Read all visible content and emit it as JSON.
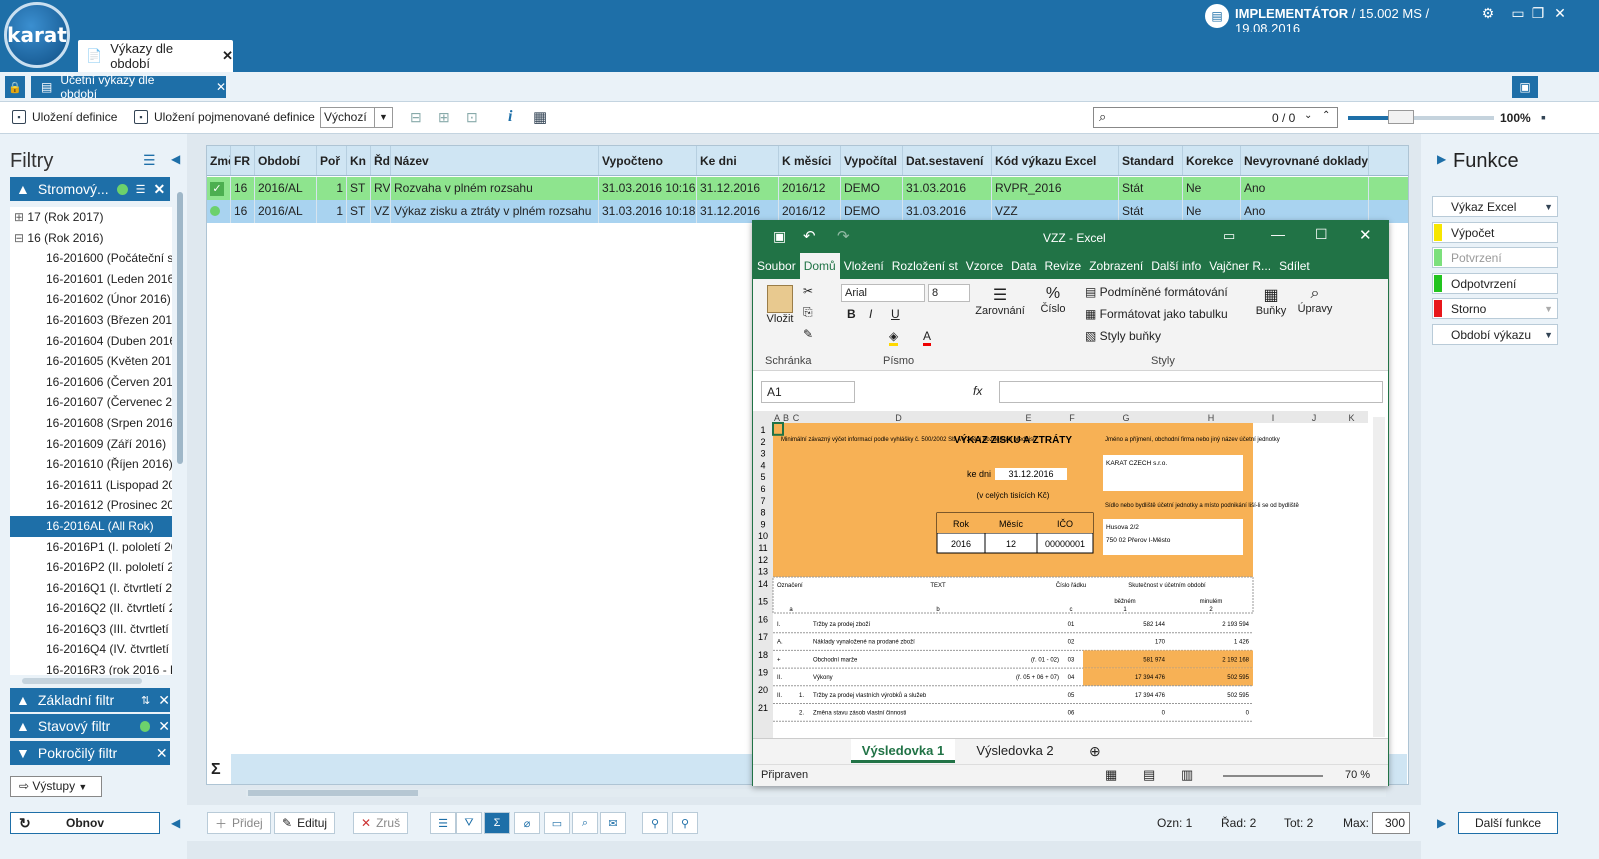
{
  "app": {
    "logo": "karat",
    "user": "IMPLEMENTÁTOR",
    "session": "/ 15.002 MS / 19.08.2016",
    "win_buttons": [
      "⚙",
      "▭",
      "❐",
      "✕"
    ]
  },
  "tabs": {
    "main": "Výkazy dle období",
    "sub": "Účetní výkazy dle období",
    "close": "✕"
  },
  "toolbar": {
    "save_def": "Uložení definice",
    "save_named": "Uložení pojmenované definice",
    "variant": "Výchozí",
    "search_count": "0 / 0",
    "zoom": "100%"
  },
  "filters": {
    "title": "Filtry",
    "tree_section": "Stromový...",
    "tree_items": [
      "17 (Rok 2017)",
      "16 (Rok 2016)",
      "16-201600 (Počáteční st",
      "16-201601 (Leden 2016)",
      "16-201602 (Únor 2016)",
      "16-201603 (Březen 2016",
      "16-201604 (Duben 2016",
      "16-201605 (Květen 2016",
      "16-201606 (Červen 2016",
      "16-201607 (Červenec 20",
      "16-201608 (Srpen 2016)",
      "16-201609 (Září 2016)",
      "16-201610 (Říjen 2016)",
      "16-201611 (Lispopad 20",
      "16-201612 (Prosinec 20:",
      "16-2016AL (All Rok)",
      "16-2016P1 (I. pololetí 20",
      "16-2016P2 (II. pololetí 2",
      "16-2016Q1 (I. čtvrtletí 2(",
      "16-2016Q2 (II. čtvrtletí 2",
      "16-2016Q3 (III. čtvrtletí :",
      "16-2016Q4 (IV. čtvrtletí",
      "16-2016R3 (rok 2016 - k"
    ],
    "basic": "Základní filtr",
    "state": "Stavový filtr",
    "advanced": "Pokročilý filtr",
    "outputs": "Výstupy",
    "refresh": "Obnov"
  },
  "grid": {
    "headers": [
      "Změ",
      "FR",
      "Období",
      "Poř",
      "Kn",
      "Řd",
      "Název",
      "Vypočteno",
      "Ke dni",
      "K měsíci",
      "Vypočítal",
      "Dat.sestavení",
      "Kód výkazu Excel",
      "Standard",
      "Korekce",
      "Nevyrovnané doklady"
    ],
    "rows": [
      [
        "16",
        "2016/AL",
        "1",
        "ST",
        "RV",
        "Rozvaha v plném rozsahu",
        "31.03.2016 10:16:",
        "31.12.2016",
        "2016/12",
        "DEMO",
        "31.03.2016",
        "RVPR_2016",
        "Stát",
        "Ne",
        "Ano"
      ],
      [
        "16",
        "2016/AL",
        "1",
        "ST",
        "VZ",
        "Výkaz zisku a ztráty v plném rozsahu",
        "31.03.2016 10:18:",
        "31.12.2016",
        "2016/12",
        "DEMO",
        "31.03.2016",
        "VZZ",
        "Stát",
        "Ne",
        "Ano"
      ]
    ],
    "sum": "Σ"
  },
  "excel": {
    "title": "VZZ - Excel",
    "menu": [
      "Soubor",
      "Domů",
      "Vložení",
      "Rozložení st",
      "Vzorce",
      "Data",
      "Revize",
      "Zobrazení",
      "Další info",
      "Vajčner R...",
      "Sdílet"
    ],
    "ribbon": {
      "paste": "Vložit",
      "clipboard": "Schránka",
      "font": "Arial",
      "size": "8",
      "font_group": "Písmo",
      "align": "Zarovnání",
      "number": "Číslo",
      "cond": "Podmíněné formátování",
      "table": "Formátovat jako tabulku",
      "styles": "Styly buňky",
      "styles_group": "Styly",
      "cells": "Buňky",
      "edit": "Úpravy"
    },
    "namebox": "A1",
    "cols": [
      "A",
      "B",
      "C",
      "D",
      "E",
      "F",
      "G",
      "H",
      "I",
      "J",
      "K"
    ],
    "sheet": {
      "note": "Minimální závazný výčet informací podle vyhlášky č. 500/2002 Sb. ve znění pozdějších předpisů",
      "heading": "VÝKAZ ZISKU A ZTRÁTY",
      "ke_dni": "ke dni",
      "date": "31.12.2016",
      "units": "(v celých tisících Kč)",
      "rok_l": "Rok",
      "mesic_l": "Měsíc",
      "ico_l": "IČO",
      "rok": "2016",
      "mesic": "12",
      "ico": "00000001",
      "firm_label": "Jméno a příjmení, obchodní firma nebo jiný název účetní jednotky",
      "firm": "KARAT CZECH s.r.o.",
      "seat_label": "Sídlo nebo bydliště účetní jednotky a místo podnikání liší-li se od bydliště",
      "street": "Husova 2/2",
      "city": "750 02  Přerov I-Město",
      "h_mark": "Označení",
      "h_text": "TEXT",
      "h_row": "Číslo řádku",
      "h_real": "Skutečnost v účetním období",
      "h_cur": "běžném",
      "h_prev": "minulém",
      "h_a": "a",
      "h_b": "b",
      "h_c": "c",
      "h_1": "1",
      "h_2": "2",
      "rows": [
        [
          "I.",
          "",
          "Tržby za prodej zboží",
          "",
          "01",
          "582 144",
          "2 193 594"
        ],
        [
          "A.",
          "",
          "Náklady vynaložené na prodané zboží",
          "",
          "02",
          "170",
          "1 426"
        ],
        [
          "+",
          "",
          "Obchodní marže",
          "(ř. 01 - 02)",
          "03",
          "581 974",
          "2 192 168"
        ],
        [
          "II.",
          "",
          "Výkony",
          "(ř. 05 + 06 + 07)",
          "04",
          "17 394 476",
          "502 595"
        ],
        [
          "II.",
          "1.",
          "Tržby za prodej vlastních výrobků a služeb",
          "",
          "05",
          "17 394 476",
          "502 595"
        ],
        [
          "",
          "2.",
          "Změna stavu zásob vlastní činnosti",
          "",
          "06",
          "0",
          "0"
        ]
      ]
    },
    "sheets": [
      "Výsledovka 1",
      "Výsledovka 2"
    ],
    "status": "Připraven",
    "zoom": "70 %"
  },
  "functions": {
    "title": "Funkce",
    "items": [
      "Výkaz Excel",
      "Výpočet",
      "Potvrzení",
      "Odpotvrzení",
      "Storno",
      "Období výkazu"
    ],
    "more": "Další funkce"
  },
  "bottom": {
    "add": "Přidej",
    "edit": "Edituj",
    "cancel": "Zruš",
    "ozn": "Ozn: 1",
    "rad": "Řad: 2",
    "tot": "Tot:  2",
    "max": "Max:",
    "max_val": "300"
  },
  "colors": {
    "brand": "#1e6fa8",
    "excel": "#217346",
    "row_green": "#7ce07c",
    "row_sel": "#a9d3f0",
    "orange": "#f7b155"
  }
}
